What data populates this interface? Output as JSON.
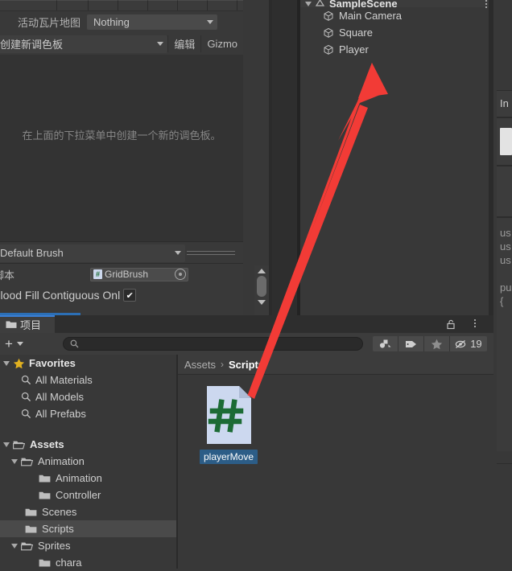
{
  "tile_palette": {
    "active_tilemap_label": "活动瓦片地图",
    "active_tilemap_value": "Nothing",
    "palette_dropdown_value": "创建新调色板",
    "edit_button": "编辑",
    "gizmos_button": "Gizmo",
    "empty_message": "在上面的下拉菜单中创建一个新的调色板。",
    "brush_dropdown_value": "Default Brush",
    "script_row_label": "脚本",
    "script_value": "GridBrush",
    "flood_fill_label": "Flood Fill Contiguous Onl",
    "flood_fill_checked": "✔"
  },
  "hierarchy": {
    "scene_name": "SampleScene",
    "objects": [
      {
        "name": "Main Camera"
      },
      {
        "name": "Square"
      },
      {
        "name": "Player"
      }
    ]
  },
  "inspector": {
    "title_fragment": "In",
    "code_fragments": [
      "us",
      "us",
      "us",
      "pu",
      "{"
    ],
    "closing_brace": "}"
  },
  "project": {
    "tab_label": "项目",
    "add_button": "+",
    "search_placeholder": "",
    "search_value": "",
    "item_count": "19",
    "lock_icon": "lock-icon",
    "menu_icon": "kebab-menu-icon",
    "breadcrumb": [
      {
        "label": "Assets",
        "active": false
      },
      {
        "label": "Scripts",
        "active": true
      }
    ],
    "breadcrumb_separator": "›",
    "tree": [
      {
        "label": "Favorites",
        "depth": 0,
        "icon": "star",
        "arrow": "down",
        "bold": true,
        "selected": false
      },
      {
        "label": "All Materials",
        "depth": 1,
        "icon": "search",
        "arrow": "none",
        "bold": false,
        "selected": false
      },
      {
        "label": "All Models",
        "depth": 1,
        "icon": "search",
        "arrow": "none",
        "bold": false,
        "selected": false
      },
      {
        "label": "All Prefabs",
        "depth": 1,
        "icon": "search",
        "arrow": "none",
        "bold": false,
        "selected": false
      },
      {
        "label": "",
        "depth": 0,
        "icon": "none",
        "arrow": "none",
        "bold": false,
        "selected": false
      },
      {
        "label": "Assets",
        "depth": 0,
        "icon": "folder-open",
        "arrow": "down",
        "bold": true,
        "selected": false
      },
      {
        "label": "Animation",
        "depth": 1,
        "icon": "folder-open",
        "arrow": "down",
        "bold": false,
        "selected": false
      },
      {
        "label": "Animation",
        "depth": 2,
        "icon": "folder",
        "arrow": "none",
        "bold": false,
        "selected": false
      },
      {
        "label": "Controller",
        "depth": 2,
        "icon": "folder",
        "arrow": "none",
        "bold": false,
        "selected": false
      },
      {
        "label": "Scenes",
        "depth": 1,
        "icon": "folder",
        "arrow": "none",
        "bold": false,
        "selected": false
      },
      {
        "label": "Scripts",
        "depth": 1,
        "icon": "folder",
        "arrow": "none",
        "bold": false,
        "selected": true
      },
      {
        "label": "Sprites",
        "depth": 1,
        "icon": "folder-open",
        "arrow": "down",
        "bold": false,
        "selected": false
      },
      {
        "label": "chara",
        "depth": 2,
        "icon": "folder",
        "arrow": "none",
        "bold": false,
        "selected": false
      }
    ],
    "assets": [
      {
        "name": "playerMove",
        "type": "csharp-script",
        "selected": true,
        "glyph": "#"
      }
    ]
  },
  "annotation": {
    "arrow_color": "#F23B36",
    "arrow_name": "red-pointer-arrow",
    "points_to": "Player"
  },
  "colors": {
    "window_bg": "#383838",
    "panel_bg": "#3c3c3c",
    "toolbar_bg": "#3b3b3b",
    "selection_blue": "#2c5d87",
    "tab_accent": "#3a7fd5",
    "script_green": "#1c6b35",
    "script_paper": "#ccd8ef",
    "favorite_gold": "#e0b020"
  }
}
